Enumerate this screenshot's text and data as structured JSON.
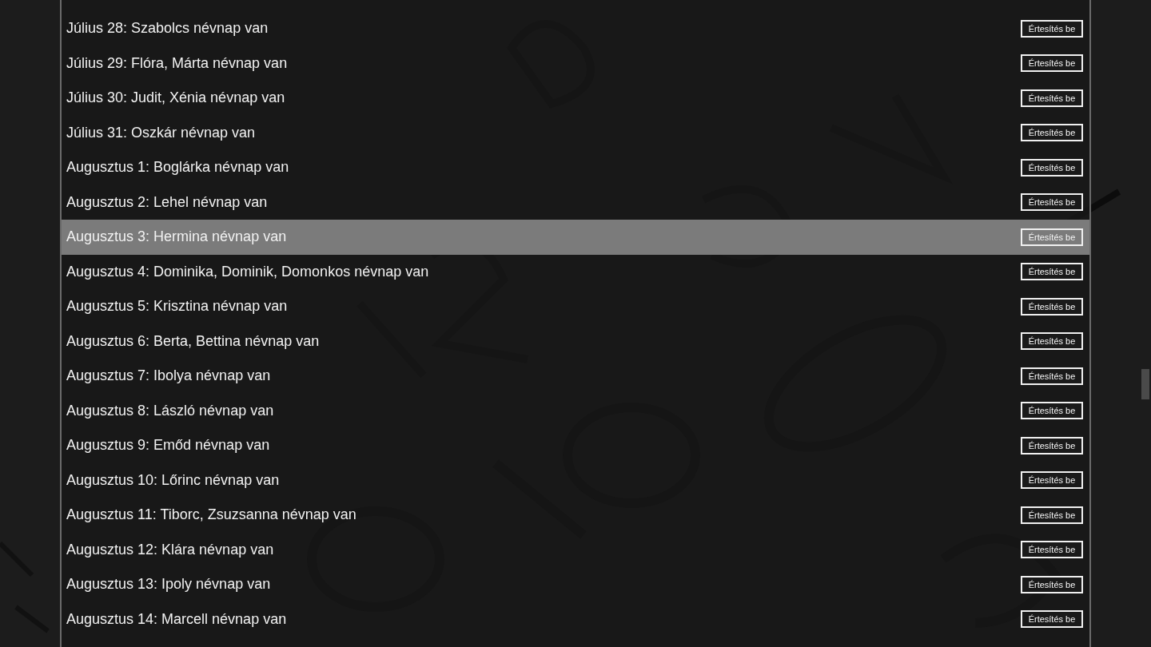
{
  "list": {
    "items": [
      {
        "label": "Július 28: Szabolcs névnap van",
        "button": "Értesítés be",
        "selected": false
      },
      {
        "label": "Július 29: Flóra, Márta névnap van",
        "button": "Értesítés be",
        "selected": false
      },
      {
        "label": "Július 30: Judit, Xénia névnap van",
        "button": "Értesítés be",
        "selected": false
      },
      {
        "label": "Július 31: Oszkár névnap van",
        "button": "Értesítés be",
        "selected": false
      },
      {
        "label": "Augusztus 1: Boglárka névnap van",
        "button": "Értesítés be",
        "selected": false
      },
      {
        "label": "Augusztus 2: Lehel névnap van",
        "button": "Értesítés be",
        "selected": false
      },
      {
        "label": "Augusztus 3: Hermina névnap van",
        "button": "Értesítés be",
        "selected": true
      },
      {
        "label": "Augusztus 4: Dominika, Dominik, Domonkos névnap van",
        "button": "Értesítés be",
        "selected": false
      },
      {
        "label": "Augusztus 5: Krisztina névnap van",
        "button": "Értesítés be",
        "selected": false
      },
      {
        "label": "Augusztus 6: Berta, Bettina névnap van",
        "button": "Értesítés be",
        "selected": false
      },
      {
        "label": "Augusztus 7: Ibolya névnap van",
        "button": "Értesítés be",
        "selected": false
      },
      {
        "label": "Augusztus 8: László névnap van",
        "button": "Értesítés be",
        "selected": false
      },
      {
        "label": "Augusztus 9: Emőd névnap van",
        "button": "Értesítés be",
        "selected": false
      },
      {
        "label": "Augusztus 10: Lőrinc névnap van",
        "button": "Értesítés be",
        "selected": false
      },
      {
        "label": "Augusztus 11: Tiborc, Zsuzsanna névnap van",
        "button": "Értesítés be",
        "selected": false
      },
      {
        "label": "Augusztus 12: Klára névnap van",
        "button": "Értesítés be",
        "selected": false
      },
      {
        "label": "Augusztus 13: Ipoly névnap van",
        "button": "Értesítés be",
        "selected": false
      },
      {
        "label": "Augusztus 14: Marcell névnap van",
        "button": "Értesítés be",
        "selected": false
      }
    ]
  }
}
